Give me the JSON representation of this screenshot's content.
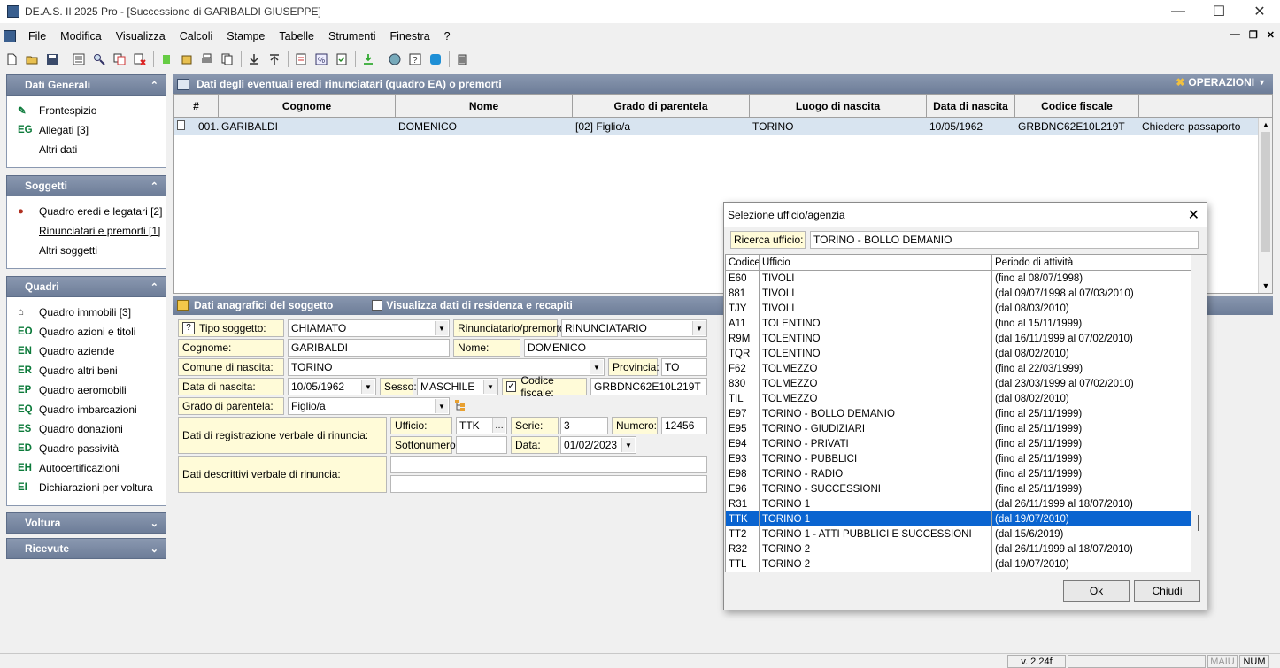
{
  "window": {
    "title": "DE.A.S. II 2025 Pro - [Successione di GARIBALDI GIUSEPPE]"
  },
  "menu": [
    "File",
    "Modifica",
    "Visualizza",
    "Calcoli",
    "Stampe",
    "Tabelle",
    "Strumenti",
    "Finestra",
    "?"
  ],
  "sidebar": {
    "panels": [
      {
        "title": "Dati Generali",
        "items": [
          {
            "icon": "F",
            "label": "Frontespizio"
          },
          {
            "icon": "EG",
            "label": "Allegati [3]"
          },
          {
            "icon": "",
            "label": "Altri dati"
          }
        ]
      },
      {
        "title": "Soggetti",
        "items": [
          {
            "icon": "Q",
            "label": "Quadro eredi e legatari [2]"
          },
          {
            "icon": "",
            "label": "Rinunciatari e premorti [1]"
          },
          {
            "icon": "",
            "label": "Altri soggetti"
          }
        ]
      },
      {
        "title": "Quadri",
        "items": [
          {
            "icon": "",
            "label": "Quadro immobili [3]"
          },
          {
            "icon": "EO",
            "label": "Quadro azioni e titoli"
          },
          {
            "icon": "EN",
            "label": "Quadro aziende"
          },
          {
            "icon": "ER",
            "label": "Quadro altri beni"
          },
          {
            "icon": "EP",
            "label": "Quadro aeromobili"
          },
          {
            "icon": "EQ",
            "label": "Quadro imbarcazioni"
          },
          {
            "icon": "ES",
            "label": "Quadro donazioni"
          },
          {
            "icon": "ED",
            "label": "Quadro passività"
          },
          {
            "icon": "EH",
            "label": "Autocertificazioni"
          },
          {
            "icon": "EI",
            "label": "Dichiarazioni per voltura"
          }
        ]
      },
      {
        "title": "Voltura",
        "items": []
      },
      {
        "title": "Ricevute",
        "items": []
      }
    ]
  },
  "main": {
    "header": "Dati degli eventuali eredi rinunciatari (quadro EA) o premorti",
    "operations": "OPERAZIONI",
    "columns": [
      "#",
      "Cognome",
      "Nome",
      "Grado di parentela",
      "Luogo di nascita",
      "Data di nascita",
      "Codice fiscale",
      ""
    ],
    "rows": [
      [
        "001.",
        "GARIBALDI",
        "DOMENICO",
        "[02] Figlio/a",
        "TORINO",
        "10/05/1962",
        "GRBDNC62E10L219T",
        "Chiedere passaporto"
      ]
    ]
  },
  "detail": {
    "header": "Dati anagrafici del soggetto",
    "toggle_label": "Visualizza dati di residenza e recapiti",
    "tipo_soggetto_label": "Tipo soggetto:",
    "tipo_soggetto": "CHIAMATO",
    "rinunciatario_label": "Rinunciatario/premorto:",
    "rinunciatario": "RINUNCIATARIO",
    "cognome_label": "Cognome:",
    "cognome": "GARIBALDI",
    "nome_label": "Nome:",
    "nome": "DOMENICO",
    "comune_label": "Comune di nascita:",
    "comune": "TORINO",
    "provincia_label": "Provincia:",
    "provincia": "TO",
    "data_nascita_label": "Data di nascita:",
    "data_nascita": "10/05/1962",
    "sesso_label": "Sesso:",
    "sesso": "MASCHILE",
    "cf_label": "Codice fiscale:",
    "cf": "GRBDNC62E10L219T",
    "grado_label": "Grado di parentela:",
    "grado": "Figlio/a",
    "reg_label": "Dati di registrazione verbale di rinuncia:",
    "ufficio_label": "Ufficio:",
    "ufficio": "TTK",
    "serie_label": "Serie:",
    "serie": "3",
    "numero_label": "Numero:",
    "numero": "12456",
    "sottonumero_label": "Sottonumero:",
    "sottonumero": "",
    "data_label": "Data:",
    "data": "01/02/2023",
    "desc_label": "Dati descrittivi verbale di rinuncia:",
    "desc1": "",
    "desc2": ""
  },
  "dialog": {
    "title": "Selezione ufficio/agenzia",
    "search_label": "Ricerca ufficio:",
    "search_value": "TORINO - BOLLO DEMANIO",
    "columns": [
      "Codice",
      "Ufficio",
      "Periodo di attività"
    ],
    "rows": [
      [
        "E60",
        "TIVOLI",
        "(fino al 08/07/1998)"
      ],
      [
        "881",
        "TIVOLI",
        "(dal 09/07/1998 al 07/03/2010)"
      ],
      [
        "TJY",
        "TIVOLI",
        "(dal 08/03/2010)"
      ],
      [
        "A11",
        "TOLENTINO",
        "(fino al 15/11/1999)"
      ],
      [
        "R9M",
        "TOLENTINO",
        "(dal 16/11/1999 al 07/02/2010)"
      ],
      [
        "TQR",
        "TOLENTINO",
        "(dal 08/02/2010)"
      ],
      [
        "F62",
        "TOLMEZZO",
        "(fino al 22/03/1999)"
      ],
      [
        "830",
        "TOLMEZZO",
        "(dal 23/03/1999 al 07/02/2010)"
      ],
      [
        "TIL",
        "TOLMEZZO",
        "(dal 08/02/2010)"
      ],
      [
        "E97",
        "TORINO - BOLLO DEMANIO",
        "(fino al 25/11/1999)"
      ],
      [
        "E95",
        "TORINO - GIUDIZIARI",
        "(fino al 25/11/1999)"
      ],
      [
        "E94",
        "TORINO - PRIVATI",
        "(fino al 25/11/1999)"
      ],
      [
        "E93",
        "TORINO - PUBBLICI",
        "(fino al 25/11/1999)"
      ],
      [
        "E98",
        "TORINO - RADIO",
        "(fino al 25/11/1999)"
      ],
      [
        "E96",
        "TORINO - SUCCESSIONI",
        "(fino al 25/11/1999)"
      ],
      [
        "R31",
        "TORINO 1",
        "(dal 26/11/1999 al 18/07/2010)"
      ],
      [
        "TTK",
        "TORINO 1",
        "(dal 19/07/2010)"
      ],
      [
        "TT2",
        "TORINO 1 - ATTI PUBBLICI E SUCCESSIONI",
        "(dal 15/6/2019)"
      ],
      [
        "R32",
        "TORINO 2",
        "(dal 26/11/1999 al 18/07/2010)"
      ],
      [
        "TTL",
        "TORINO 2",
        "(dal 19/07/2010)"
      ]
    ],
    "selected_index": 16,
    "ok_label": "Ok",
    "close_label": "Chiudi"
  },
  "status": {
    "version": "v. 2.24f",
    "caps": "MAIU",
    "num": "NUM"
  }
}
